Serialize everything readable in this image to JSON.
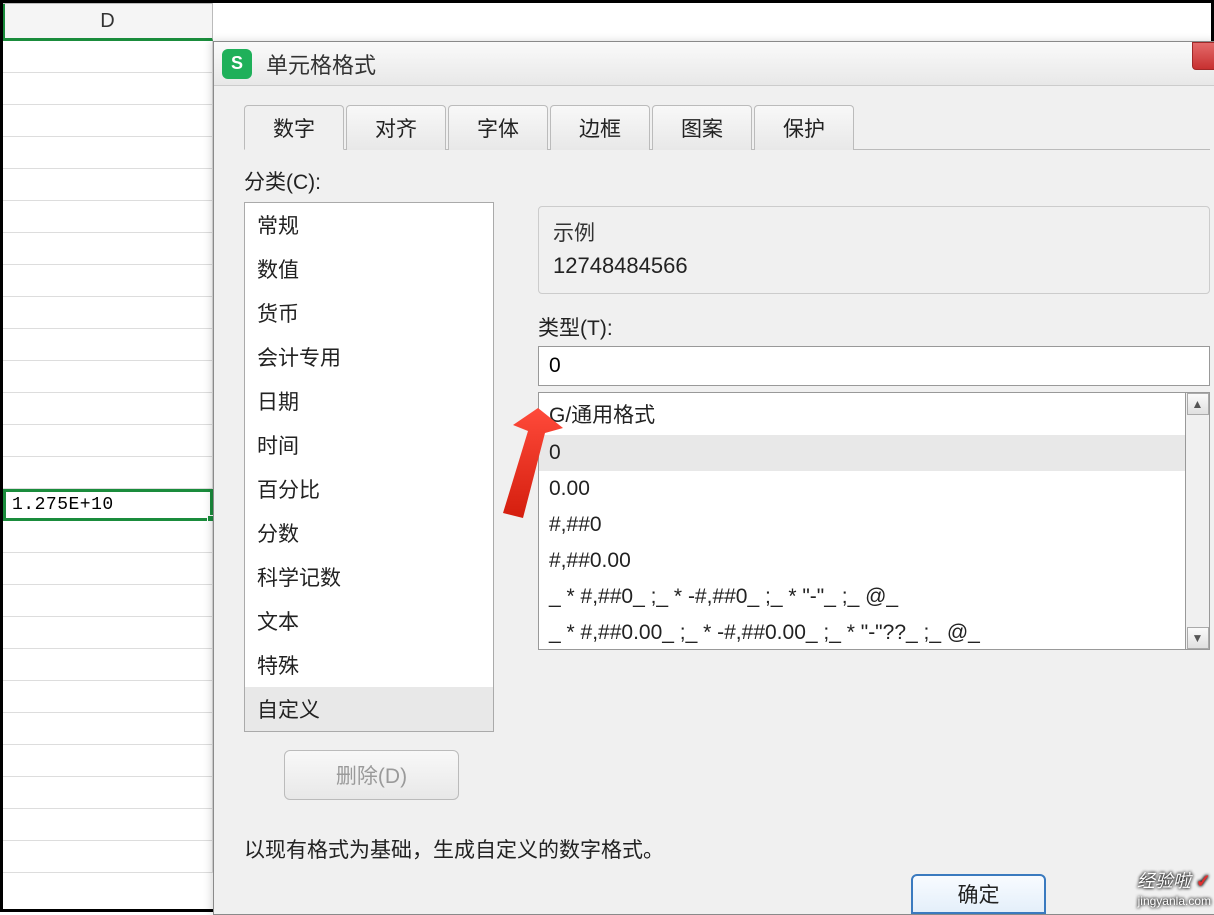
{
  "spreadsheet": {
    "column_header": "D",
    "selected_cell_value": "1.275E+10"
  },
  "dialog": {
    "title": "单元格格式",
    "tabs": [
      {
        "label": "数字",
        "active": true
      },
      {
        "label": "对齐",
        "active": false
      },
      {
        "label": "字体",
        "active": false
      },
      {
        "label": "边框",
        "active": false
      },
      {
        "label": "图案",
        "active": false
      },
      {
        "label": "保护",
        "active": false
      }
    ],
    "category_label": "分类(C):",
    "categories": [
      "常规",
      "数值",
      "货币",
      "会计专用",
      "日期",
      "时间",
      "百分比",
      "分数",
      "科学记数",
      "文本",
      "特殊",
      "自定义"
    ],
    "selected_category_index": 11,
    "example_label": "示例",
    "example_value": "12748484566",
    "type_label": "类型(T):",
    "type_value": "0",
    "formats": [
      "G/通用格式",
      "0",
      "0.00",
      "#,##0",
      "#,##0.00",
      "_ * #,##0_ ;_ * -#,##0_ ;_ * \"-\"_ ;_ @_",
      "_ * #,##0.00_ ;_ * -#,##0.00_ ;_ * \"-\"??_ ;_ @_"
    ],
    "selected_format_index": 1,
    "delete_label": "删除(D)",
    "hint": "以现有格式为基础，生成自定义的数字格式。",
    "ok_label": "确定"
  },
  "watermark": {
    "brand": "经验啦",
    "url": "jingyanla.com"
  }
}
